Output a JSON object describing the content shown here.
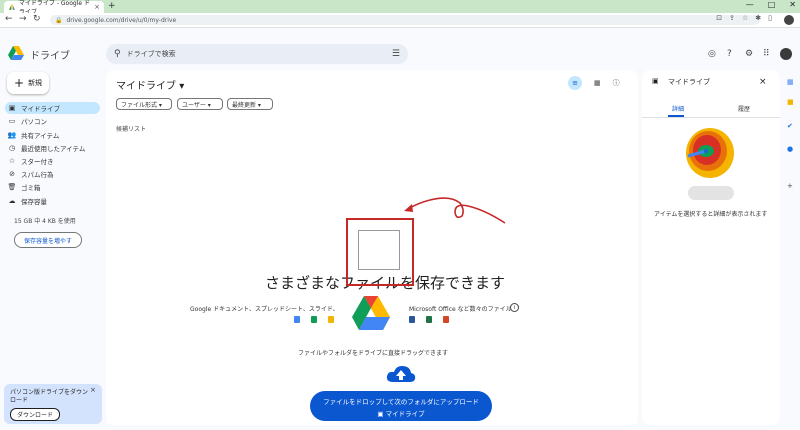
{
  "browser": {
    "tab_title": "マイドライブ - Google ドライブ",
    "tab_close": "×",
    "new_tab": "+",
    "url": "drive.google.com/drive/u/0/my-drive",
    "window_buttons": [
      "—",
      "□",
      "✕"
    ]
  },
  "header": {
    "app_name": "ドライブ",
    "search_placeholder": "ドライブで検索"
  },
  "sidebar": {
    "new_label": "新規",
    "items": [
      {
        "icon": "▣",
        "label": "マイドライブ",
        "active": true
      },
      {
        "icon": "▭",
        "label": "パソコン"
      },
      {
        "icon": "👥",
        "label": "共有アイテム"
      },
      {
        "icon": "◷",
        "label": "最近使用したアイテム"
      },
      {
        "icon": "☆",
        "label": "スター付き"
      },
      {
        "icon": "⊘",
        "label": "スパム行為"
      },
      {
        "icon": "🗑",
        "label": "ゴミ箱"
      },
      {
        "icon": "☁",
        "label": "保存容量"
      }
    ],
    "storage_text": "15 GB 中 4 KB を使用",
    "get_storage": "保存容量を増やす",
    "download_card": {
      "text": "パソコン版ドライブをダウンロード",
      "close": "×",
      "button": "ダウンロード"
    }
  },
  "main": {
    "title": "マイドライブ",
    "title_caret": "▾",
    "filters": [
      "ファイル形式 ▾",
      "ユーザー ▾",
      "最終更新 ▾"
    ],
    "candidates_label": "候補リスト",
    "big_message": "さまざまなファイルを保存できます",
    "google_docs_text": "Google ドキュメント、スプレッドシート、スライド、",
    "ms_office_text": "Microsoft Office など数々のファイル",
    "info_mark": "i",
    "drag_message": "ファイルやフォルダをドライブに直接ドラッグできます",
    "upload_button_line1": "ファイルをドロップして次のフォルダにアップロード",
    "upload_button_line2": "マイドライブ",
    "upload_folder_icon": "▣"
  },
  "details": {
    "title": "マイドライブ",
    "close": "×",
    "tab_details": "詳細",
    "tab_activity": "履歴",
    "select_message": "アイテムを選択すると詳細が表示されます"
  },
  "colors": {
    "accent": "#0b57d0",
    "active_bg": "#c2e7ff",
    "annotation_red": "#c62828"
  }
}
